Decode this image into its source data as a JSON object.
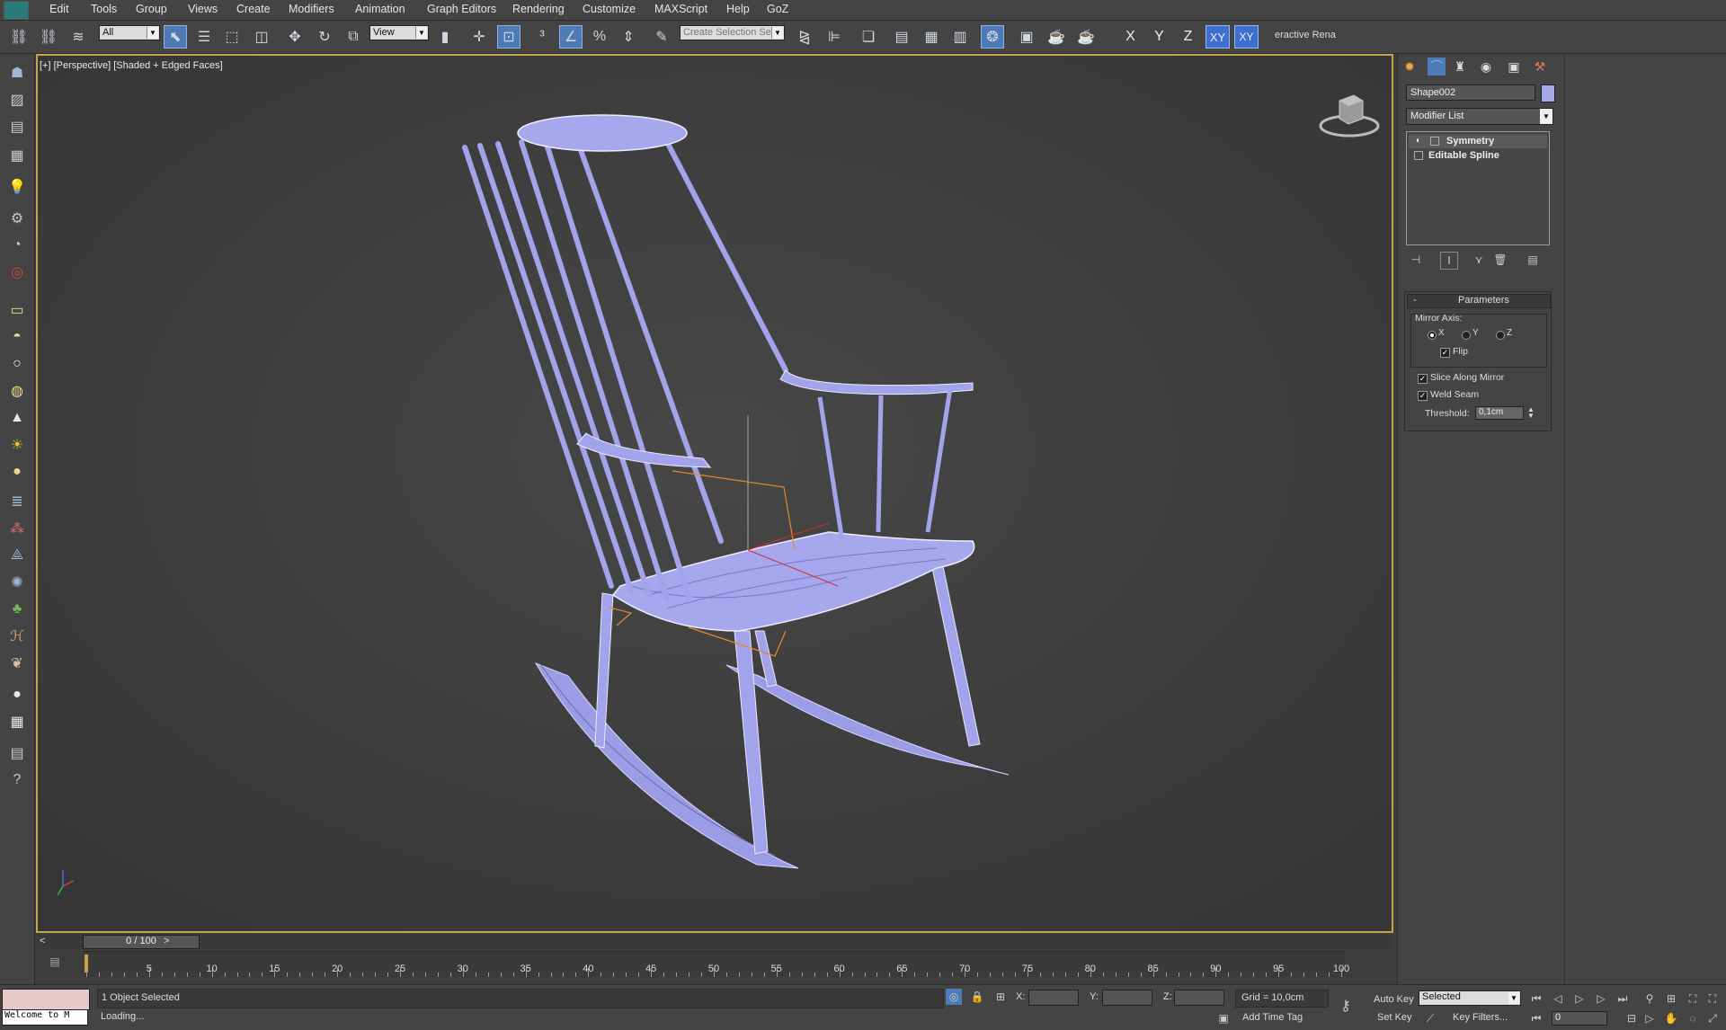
{
  "menubar": {
    "items": [
      "Edit",
      "Tools",
      "Group",
      "Views",
      "Create",
      "Modifiers",
      "Animation",
      "Graph Editors",
      "Rendering",
      "Customize",
      "MAXScript",
      "Help",
      "GoZ"
    ]
  },
  "toolbar": {
    "selection_filter": "All",
    "ref_coord_system": "View",
    "named_selection_placeholder": "Create Selection Se",
    "axis_buttons": [
      "X",
      "Y",
      "Z",
      "XY",
      "XY"
    ],
    "interactive_render_label": "eractive Rena"
  },
  "viewport": {
    "label": "[+] [Perspective] [Shaded + Edged Faces]",
    "model_color": "#9b9be6",
    "selection_color": "#e08a2a"
  },
  "command_panel": {
    "object_name": "Shape002",
    "object_color": "#a8a8e8",
    "modifier_list_label": "Modifier List",
    "modifier_stack": [
      "Symmetry",
      "Editable Spline"
    ],
    "parameters_title": "Parameters",
    "mirror_axis_label": "Mirror Axis:",
    "axis_options": [
      "X",
      "Y",
      "Z"
    ],
    "selected_axis": "X",
    "flip_label": "Flip",
    "slice_label": "Slice Along Mirror",
    "weld_label": "Weld Seam",
    "threshold_label": "Threshold:",
    "threshold_value": "0,1cm"
  },
  "timeline": {
    "frame_readout": "0 / 100",
    "ticks": [
      "5",
      "10",
      "15",
      "20",
      "25",
      "30",
      "35",
      "40",
      "45",
      "50",
      "55",
      "60",
      "65",
      "70",
      "75",
      "80",
      "85",
      "90",
      "95",
      "100"
    ]
  },
  "statusbar": {
    "maxscript_listener": "Welcome to M",
    "selection_status": "1 Object Selected",
    "prompt": "Loading...",
    "x_label": "X:",
    "y_label": "Y:",
    "z_label": "Z:",
    "grid": "Grid = 10,0cm",
    "add_time_tag": "Add Time Tag",
    "auto_key": "Auto Key",
    "set_key": "Set Key",
    "key_mode": "Selected",
    "key_filters": "Key Filters...",
    "current_frame": "0"
  }
}
